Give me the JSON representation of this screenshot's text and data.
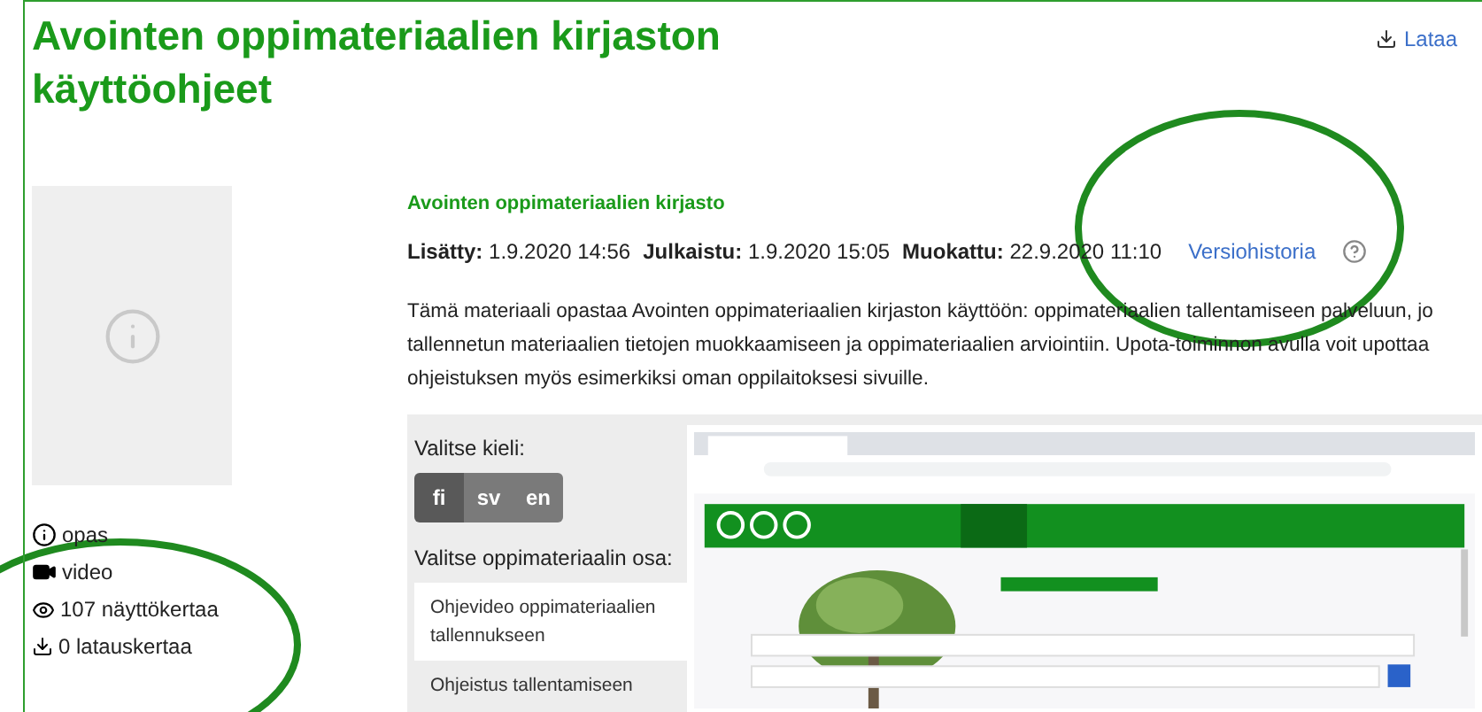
{
  "title_lines": [
    "Avointen oppimateriaalien kirjaston",
    "käyttöohjeet"
  ],
  "download_link": "Lataa",
  "meta_list": [
    {
      "kind": "info",
      "text": "opas"
    },
    {
      "kind": "video",
      "text": "video"
    },
    {
      "kind": "views",
      "text": "107 näyttökertaa"
    },
    {
      "kind": "downloads",
      "text": "0 latauskertaa"
    }
  ],
  "publisher": "Avointen oppimateriaalien kirjasto",
  "dates": [
    {
      "label": "Lisätty:",
      "value": "1.9.2020 14:56"
    },
    {
      "label": "Julkaistu:",
      "value": "1.9.2020 15:05"
    },
    {
      "label": "Muokattu:",
      "value": "22.9.2020 11:10"
    }
  ],
  "version_link": "Versiohistoria",
  "description_lines": [
    "Tämä materiaali opastaa Avointen oppimateriaalien kirjaston käyttöön: oppimateriaalien tallentamiseen palveluun, jo",
    "tallennetun materiaalien tietojen muokkaamiseen ja oppimateriaalien arviointiin. Upota-toiminnon avulla voit upottaa",
    "ohjeistuksen myös esimerkiksi oman oppilaitoksesi sivuille."
  ],
  "viewer": {
    "language_heading": "Valitse kieli:",
    "languages": [
      {
        "label": "fi",
        "selected": true
      },
      {
        "label": "sv",
        "selected": false
      },
      {
        "label": "en",
        "selected": false
      }
    ],
    "part_heading": "Valitse oppimateriaalin osa:",
    "parts": [
      {
        "label": "Ohjevideo oppimateriaalien tallennukseen",
        "selected": true
      },
      {
        "label": "Ohjeistus tallentamiseen",
        "selected": false
      }
    ]
  }
}
